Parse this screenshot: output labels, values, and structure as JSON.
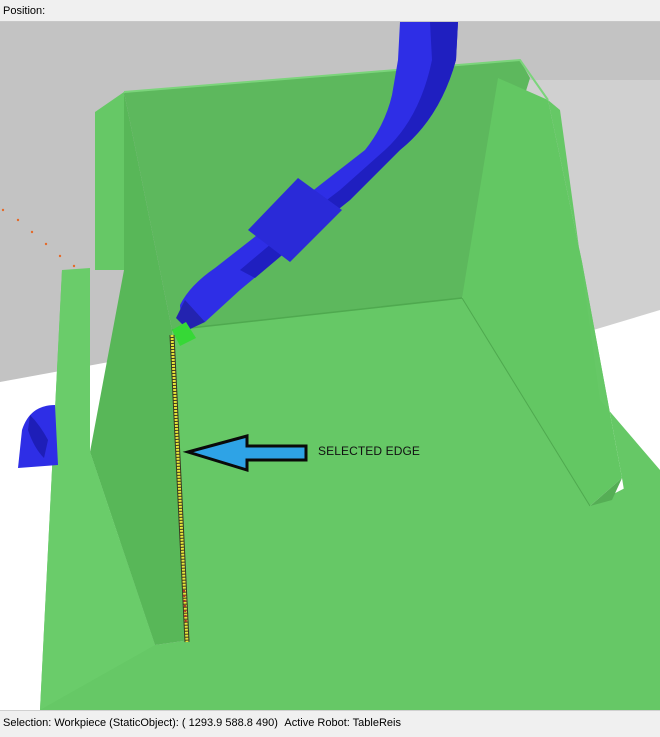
{
  "header": {
    "position_label": "Position:"
  },
  "viewport": {
    "annotation_text": "SELECTED EDGE",
    "colors": {
      "background_upper": "#c3c3c3",
      "floor": "#ffffff",
      "workpiece": "#66c866",
      "workpiece_dark": "#57b857",
      "robot": "#2e2ee6",
      "selected_edge": "#e8e63a",
      "arrow": "#2ea3e6"
    }
  },
  "status": {
    "selection": "Selection: Workpiece (StaticObject): ( 1293.9 588.8 490)",
    "active_robot": "Active Robot: TableReis"
  }
}
